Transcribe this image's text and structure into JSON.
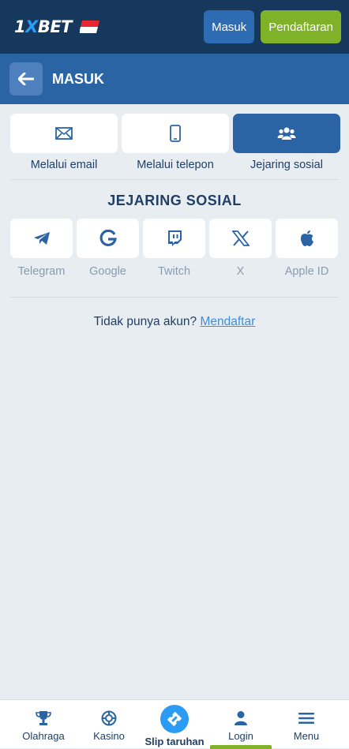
{
  "header": {
    "logo_prefix": "1",
    "logo_x": "X",
    "logo_suffix": "BET",
    "login_label": "Masuk",
    "register_label": "Pendaftaran",
    "flag_colors": {
      "top": "#e7262d",
      "bottom": "#ffffff"
    },
    "colors": {
      "bg": "#16385c",
      "login": "#2d6cb3",
      "register": "#7fb229"
    }
  },
  "title_bar": {
    "title": "MASUK",
    "back_icon": "arrow-left-icon"
  },
  "tabs": [
    {
      "label": "Melalui email",
      "icon": "envelope-icon",
      "active": false
    },
    {
      "label": "Melalui telepon",
      "icon": "phone-icon",
      "active": false
    },
    {
      "label": "Jejaring sosial",
      "icon": "users-icon",
      "active": true
    }
  ],
  "social": {
    "heading": "JEJARING SOSIAL",
    "items": [
      {
        "label": "Telegram",
        "icon": "telegram-icon"
      },
      {
        "label": "Google",
        "icon": "google-icon"
      },
      {
        "label": "Twitch",
        "icon": "twitch-icon"
      },
      {
        "label": "X",
        "icon": "x-icon"
      },
      {
        "label": "Apple ID",
        "icon": "apple-icon"
      }
    ]
  },
  "no_account": {
    "text": "Tidak punya akun?",
    "link": "Mendaftar"
  },
  "bottom_nav": [
    {
      "label": "Olahraga",
      "icon": "trophy-icon"
    },
    {
      "label": "Kasino",
      "icon": "casino-chip-icon"
    },
    {
      "label": "Slip taruhan",
      "icon": "ticket-icon"
    },
    {
      "label": "Login",
      "icon": "user-icon",
      "active": true
    },
    {
      "label": "Menu",
      "icon": "hamburger-icon"
    }
  ]
}
